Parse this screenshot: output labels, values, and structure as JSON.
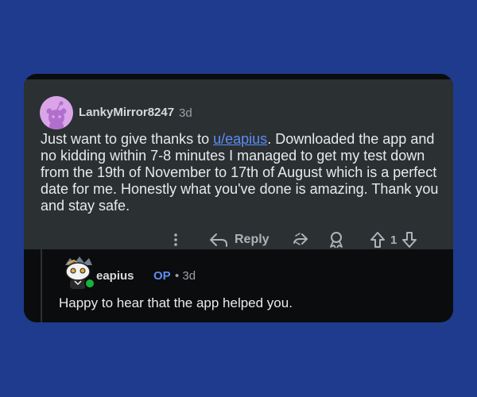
{
  "comment": {
    "username": "LankyMirror8247",
    "time": "3d",
    "text_before": "Just want to give thanks to ",
    "link": "u/eapius",
    "text_after": ". Downloaded the app and no kidding within 7-8 minutes I managed to get my test down from the 19th of November to 17th of August which is a perfect date for me. Honestly what you've done is amazing. Thank you and stay safe.",
    "actions": {
      "more_icon": "more-vertical-icon",
      "reply_label": "Reply",
      "share_icon": "share-icon",
      "award_icon": "award-icon",
      "vote_count": "1"
    }
  },
  "reply": {
    "username": "eapius",
    "op_badge": "OP",
    "time": "• 3d",
    "text": "Happy to hear that the app helped you."
  },
  "colors": {
    "background": "#1f3b8e",
    "card": "#2b3033",
    "link": "#5b8ef5",
    "online": "#18b33a"
  }
}
